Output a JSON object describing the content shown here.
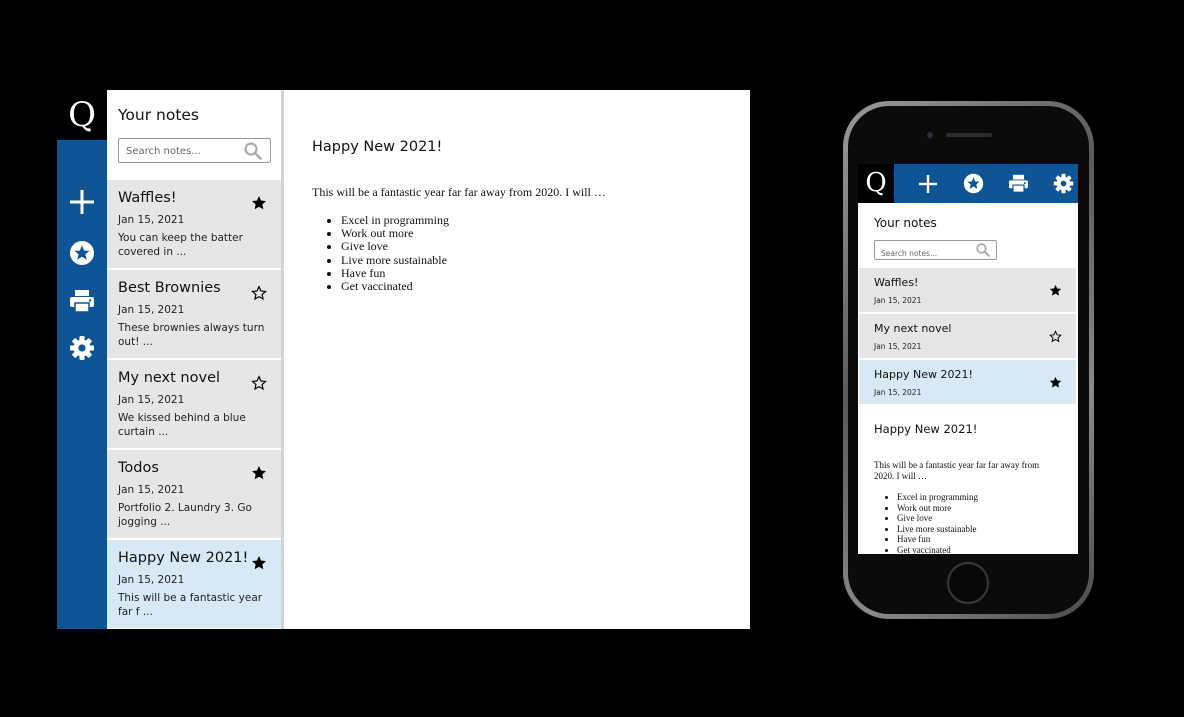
{
  "app": {
    "logo": "Q",
    "accent": "#0f5596",
    "active_note_bg": "#d8e9f6",
    "note_bg": "#e6e6e6"
  },
  "sidebar": {
    "buttons": [
      {
        "name": "add-note",
        "icon": "plus-icon"
      },
      {
        "name": "favorites",
        "icon": "star-circle-icon"
      },
      {
        "name": "print",
        "icon": "printer-icon"
      },
      {
        "name": "settings",
        "icon": "gear-icon"
      }
    ]
  },
  "notes_panel": {
    "title": "Your notes",
    "search_placeholder": "Search notes...",
    "notes": [
      {
        "title": "Waffles!",
        "date": "Jan 15, 2021",
        "snippet": "You can keep the batter covered in ...",
        "starred": true
      },
      {
        "title": "Best Brownies",
        "date": "Jan 15, 2021",
        "snippet": "These brownies always turn out! ...",
        "starred": false
      },
      {
        "title": "My next novel",
        "date": "Jan 15, 2021",
        "snippet": "We kissed behind a blue curtain ...",
        "starred": false
      },
      {
        "title": "Todos",
        "date": "Jan 15, 2021",
        "snippet": "Portfolio 2. Laundry 3. Go jogging ...",
        "starred": true
      },
      {
        "title": "Happy New 2021!",
        "date": "Jan 15, 2021",
        "snippet": "This will be a fantastic year far f ...",
        "starred": true,
        "active": true
      }
    ]
  },
  "editor": {
    "title": "Happy New 2021!",
    "intro": "This will be a fantastic year far far away from 2020. I will …",
    "items": [
      "Excel in programming",
      "Work out more",
      "Give love",
      "Live more sustainable",
      "Have fun",
      "Get vaccinated"
    ]
  },
  "mobile": {
    "notes": [
      {
        "title": "Waffles!",
        "date": "Jan 15, 2021",
        "starred": true
      },
      {
        "title": "My next novel",
        "date": "Jan 15, 2021",
        "starred": false
      },
      {
        "title": "Happy New 2021!",
        "date": "Jan 15, 2021",
        "starred": true,
        "active": true
      }
    ]
  }
}
